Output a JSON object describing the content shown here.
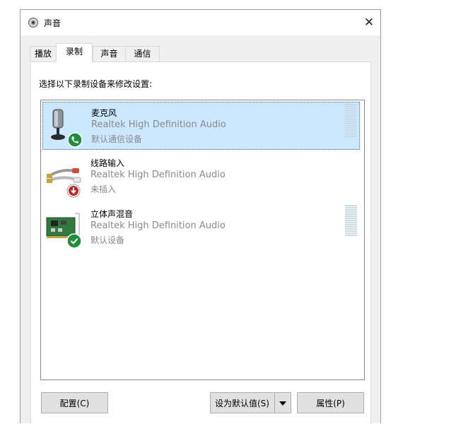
{
  "window": {
    "title": "声音",
    "close_glyph": "✕"
  },
  "tabs": [
    {
      "label": "播放",
      "active": false
    },
    {
      "label": "录制",
      "active": true
    },
    {
      "label": "声音",
      "active": false
    },
    {
      "label": "通信",
      "active": false
    }
  ],
  "instruction": "选择以下录制设备来修改设置:",
  "devices": [
    {
      "name": "麦克风",
      "driver": "Realtek High Definition Audio",
      "status": "默认通信设备",
      "icon": "microphone-icon",
      "badge": "phone-badge-icon",
      "selected": true,
      "has_meter": true
    },
    {
      "name": "线路输入",
      "driver": "Realtek High Definition Audio",
      "status": "未插入",
      "icon": "line-in-cable-icon",
      "badge": "unplugged-badge-icon",
      "selected": false,
      "has_meter": false
    },
    {
      "name": "立体声混音",
      "driver": "Realtek High Definition Audio",
      "status": "默认设备",
      "icon": "sound-card-icon",
      "badge": "default-check-badge-icon",
      "selected": false,
      "has_meter": true
    }
  ],
  "buttons": {
    "configure": "配置(C)",
    "set_default": "设为默认值(S)",
    "properties": "属性(P)"
  },
  "colors": {
    "selection": "#cce8ff",
    "green_badge": "#1e8f3a",
    "red_badge": "#d11f1f",
    "meter": "#c7dbe9"
  }
}
